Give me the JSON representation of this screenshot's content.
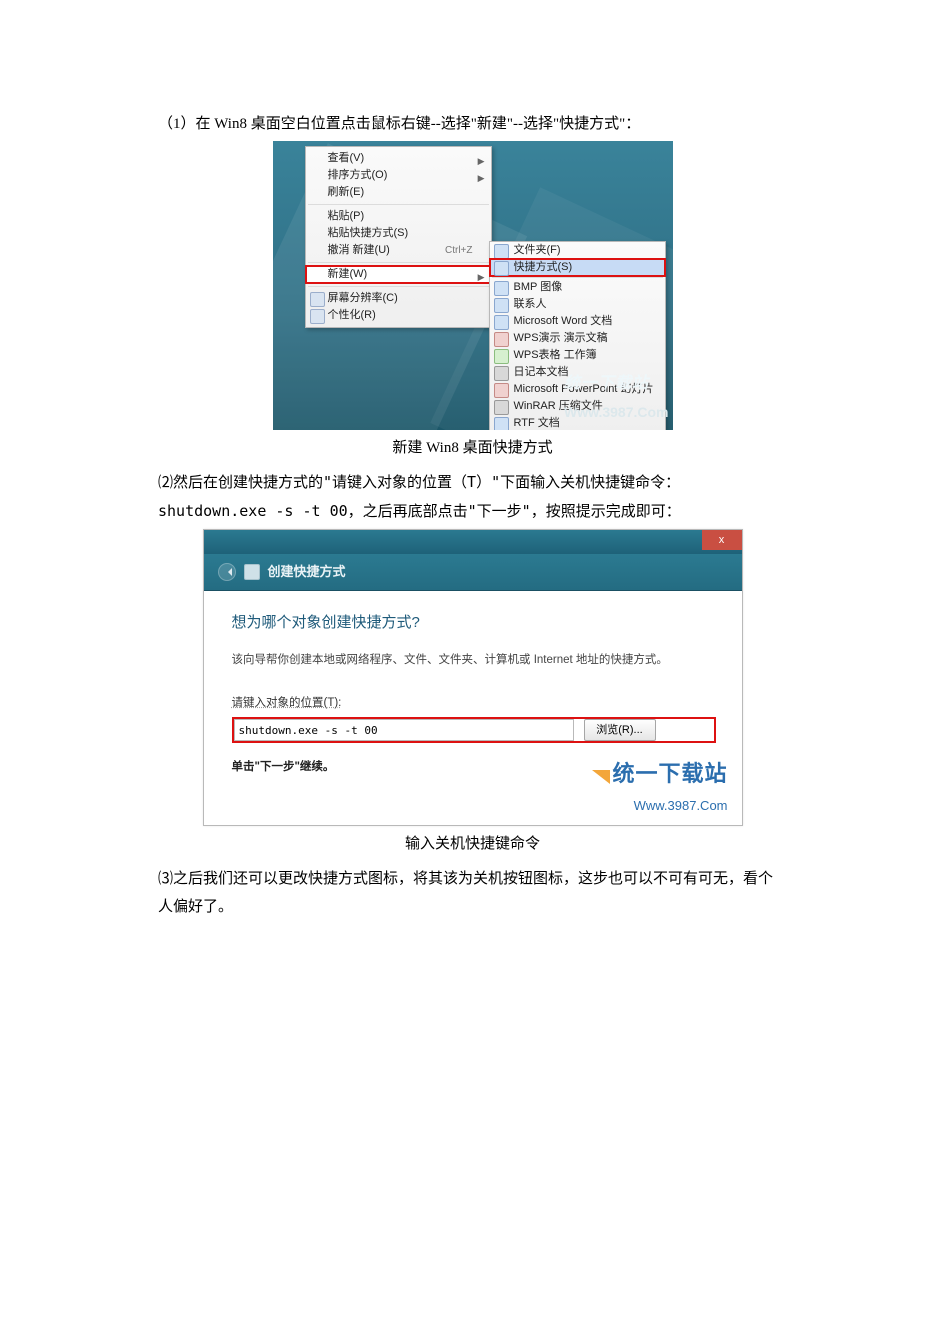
{
  "step1_text": "（1）在 Win8 桌面空白位置点击鼠标右键--选择\"新建\"--选择\"快捷方式\"：",
  "screenshot1": {
    "menu1": {
      "group1": [
        {
          "label": "查看(V)",
          "arrow": true
        },
        {
          "label": "排序方式(O)",
          "arrow": true
        },
        {
          "label": "刷新(E)"
        }
      ],
      "group2": [
        {
          "label": "粘贴(P)"
        },
        {
          "label": "粘贴快捷方式(S)"
        },
        {
          "label": "撤消 新建(U)",
          "hint": "Ctrl+Z"
        }
      ],
      "group3": [
        {
          "label": "新建(W)",
          "arrow": true,
          "highlight": true
        }
      ],
      "group4": [
        {
          "label": "屏幕分辨率(C)",
          "icon": true
        },
        {
          "label": "个性化(R)",
          "icon": true
        }
      ]
    },
    "menu2": [
      {
        "label": "文件夹(F)",
        "ico": "blue"
      },
      {
        "label": "快捷方式(S)",
        "ico": "blue",
        "highlight": true,
        "sep_after": true
      },
      {
        "label": "BMP 图像",
        "ico": "blue"
      },
      {
        "label": "联系人",
        "ico": "blue"
      },
      {
        "label": "Microsoft Word 文档",
        "ico": "blue"
      },
      {
        "label": "WPS演示 演示文稿",
        "ico": "red"
      },
      {
        "label": "WPS表格 工作簿",
        "ico": "green"
      },
      {
        "label": "日记本文档",
        "ico": "dark"
      },
      {
        "label": "Microsoft PowerPoint 幻灯片",
        "ico": "red"
      },
      {
        "label": "WinRAR 压缩文件",
        "ico": "dark"
      },
      {
        "label": "RTF 文档",
        "ico": "blue"
      }
    ],
    "watermark_title": "统一下载站",
    "watermark_url": "Www.3987.Com"
  },
  "caption1": "新建 Win8 桌面快捷方式",
  "step2_text": "⑵然后在创建快捷方式的\"请键入对象的位置（T）\"下面输入关机快捷键命令：shutdown.exe -s -t 00，之后再底部点击\"下一步\"，按照提示完成即可：",
  "screenshot2": {
    "close_label": "x",
    "wizard_title": "创建快捷方式",
    "question": "想为哪个对象创建快捷方式?",
    "desc": "该向导帮你创建本地或网络程序、文件、文件夹、计算机或 Internet 地址的快捷方式。",
    "field_label": "请键入对象的位置(T):",
    "field_value": "shutdown.exe -s -t 00",
    "browse_label": "浏览(R)...",
    "next_line": "单击\"下一步\"继续。",
    "watermark_title": "统一下载站",
    "watermark_url": "Www.3987.Com"
  },
  "caption2": "输入关机快捷键命令",
  "step3_text": "⑶之后我们还可以更改快捷方式图标，将其该为关机按钮图标，这步也可以不可有可无，看个人偏好了。"
}
